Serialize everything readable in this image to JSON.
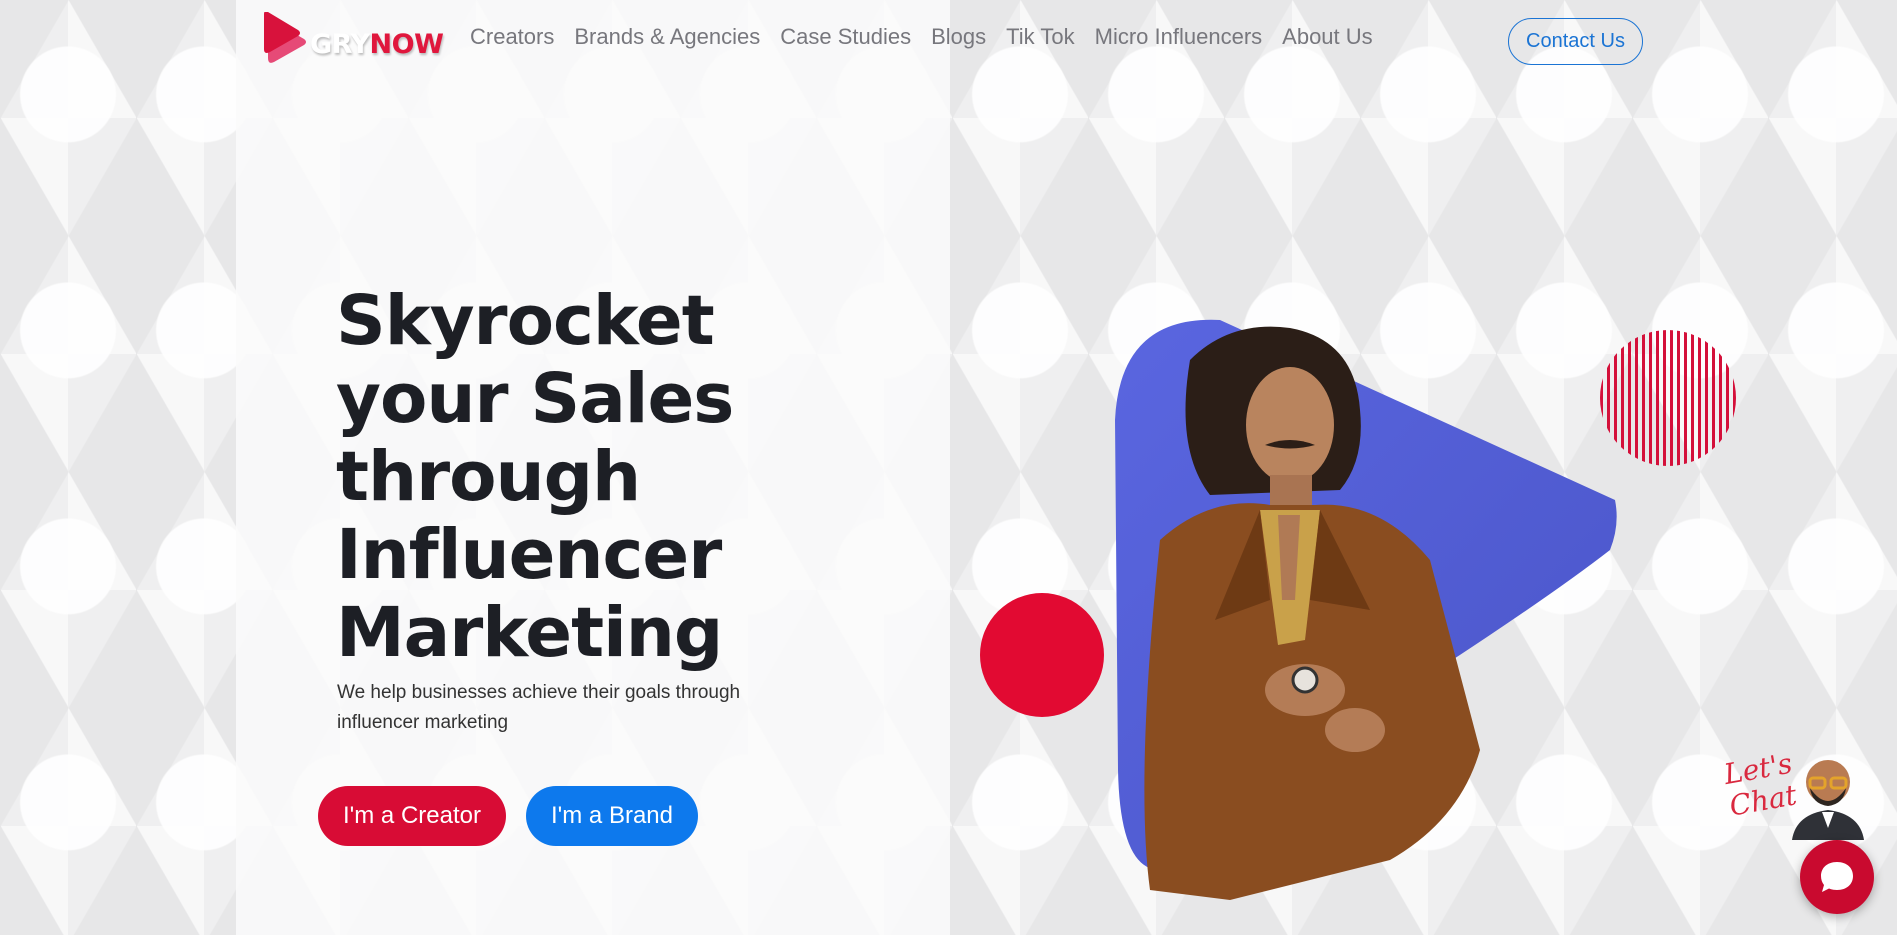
{
  "brand": {
    "logo_part1": "GRY",
    "logo_part2": "NOW",
    "accent": "#e0173d"
  },
  "nav": {
    "items": [
      "Creators",
      "Brands & Agencies",
      "Case Studies",
      "Blogs",
      "Tik Tok",
      "Micro Influencers",
      "About Us"
    ],
    "contact_label": "Contact Us"
  },
  "hero": {
    "title": "Skyrocket your Sales through Influencer Marketing",
    "subtitle": "We help businesses achieve their goals through influencer marketing",
    "creator_button": "I'm a Creator",
    "brand_button": "I'm a Brand"
  },
  "chat": {
    "label_line1": "Let's",
    "label_line2": "Chat",
    "icon": "chat-bubble-icon"
  },
  "colors": {
    "primary_red": "#d80c35",
    "primary_blue": "#0d79ed",
    "play_shape_blue": "#4f5bd5",
    "title": "#1d1f25"
  }
}
